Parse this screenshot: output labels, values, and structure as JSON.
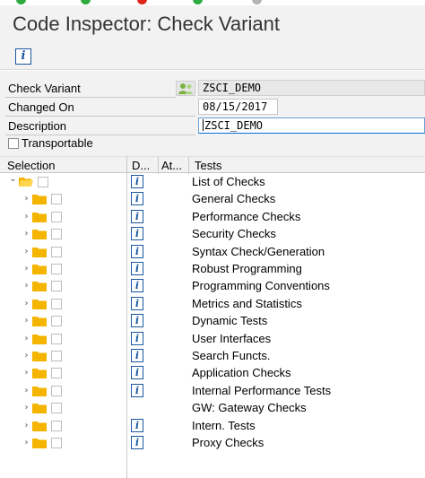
{
  "window": {
    "title": "Code Inspector: Check Variant"
  },
  "toolbar": {
    "info_icon": "info-icon",
    "info_glyph": "i"
  },
  "form": {
    "check_variant": {
      "label": "Check Variant",
      "value": "ZSCI_DEMO"
    },
    "changed_on": {
      "label": "Changed On",
      "value": "08/15/2017"
    },
    "description": {
      "label": "Description",
      "value": "ZSCI_DEMO"
    },
    "transportable": {
      "label": "Transportable",
      "checked": false
    }
  },
  "tree": {
    "columns": {
      "selection": "Selection",
      "docs": "D...",
      "attributes": "At...",
      "tests": "Tests"
    },
    "info_glyph": "i",
    "rows": [
      {
        "label": "List of Checks",
        "level": 0,
        "expanded": true,
        "has_info": true
      },
      {
        "label": "General Checks",
        "level": 1,
        "expanded": false,
        "has_info": true
      },
      {
        "label": "Performance Checks",
        "level": 1,
        "expanded": false,
        "has_info": true
      },
      {
        "label": "Security Checks",
        "level": 1,
        "expanded": false,
        "has_info": true
      },
      {
        "label": "Syntax Check/Generation",
        "level": 1,
        "expanded": false,
        "has_info": true
      },
      {
        "label": "Robust Programming",
        "level": 1,
        "expanded": false,
        "has_info": true
      },
      {
        "label": "Programming Conventions",
        "level": 1,
        "expanded": false,
        "has_info": true
      },
      {
        "label": "Metrics and Statistics",
        "level": 1,
        "expanded": false,
        "has_info": true
      },
      {
        "label": "Dynamic Tests",
        "level": 1,
        "expanded": false,
        "has_info": true
      },
      {
        "label": "User Interfaces",
        "level": 1,
        "expanded": false,
        "has_info": true
      },
      {
        "label": "Search Functs.",
        "level": 1,
        "expanded": false,
        "has_info": true
      },
      {
        "label": "Application Checks",
        "level": 1,
        "expanded": false,
        "has_info": true
      },
      {
        "label": "Internal Performance Tests",
        "level": 1,
        "expanded": false,
        "has_info": true
      },
      {
        "label": "GW: Gateway Checks",
        "level": 1,
        "expanded": false,
        "has_info": false
      },
      {
        "label": "Intern. Tests",
        "level": 1,
        "expanded": false,
        "has_info": true
      },
      {
        "label": "Proxy Checks",
        "level": 1,
        "expanded": false,
        "has_info": true
      }
    ]
  },
  "colors": {
    "folder": "#f5b400",
    "info_blue": "#1a57a0",
    "light_green": "#2eab3f",
    "light_red": "#e1251b"
  }
}
